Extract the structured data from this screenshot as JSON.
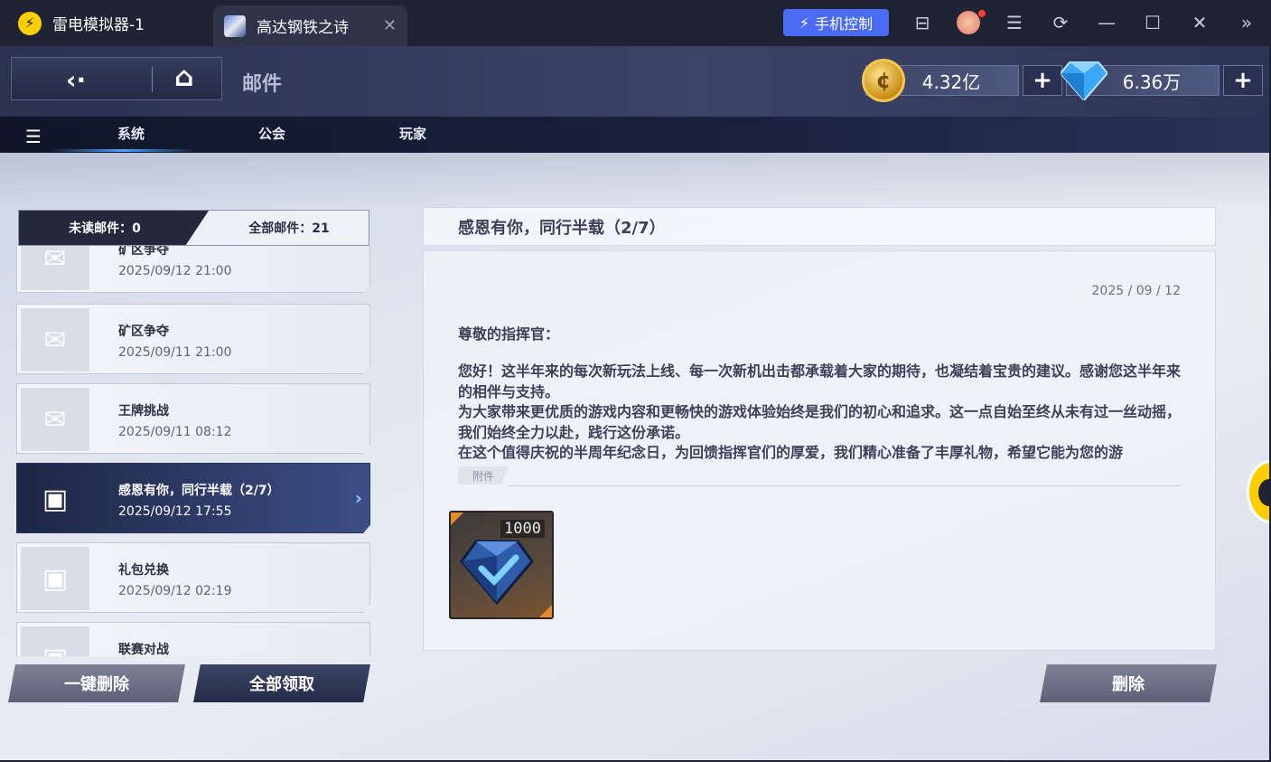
{
  "emulator": {
    "app_title": "雷电模拟器-1",
    "game_tab_title": "高达钢铁之诗",
    "phone_control_label": "手机控制",
    "tab_close": "✕",
    "icons": [
      "lightning-icon",
      "toolbox-icon",
      "avatar-icon",
      "menu-icon",
      "rotate-icon",
      "minimize-icon",
      "maximize-icon",
      "close-icon",
      "more-icon"
    ]
  },
  "game": {
    "page_title": "邮件",
    "currency": {
      "gold": "4.32亿",
      "diamond": "6.36万",
      "plus": "+"
    },
    "tabs": [
      "系统",
      "公会",
      "玩家"
    ],
    "active_tab": "系统",
    "counter": {
      "unread": "未读邮件：0",
      "all": "全部邮件：21"
    },
    "mails": [
      {
        "title": "矿区争夺",
        "date": "2025/09/12  21:00",
        "icon": "envelope-icon",
        "active": false
      },
      {
        "title": "矿区争夺",
        "date": "2025/09/11  21:00",
        "icon": "envelope-icon",
        "active": false
      },
      {
        "title": "王牌挑战",
        "date": "2025/09/11  08:12",
        "icon": "envelope-icon",
        "active": false
      },
      {
        "title": "感恩有你，同行半载（2/7）",
        "date": "2025/09/12  17:55",
        "icon": "giftbox-icon",
        "active": true
      },
      {
        "title": "礼包兑换",
        "date": "2025/09/12  02:19",
        "icon": "giftbox-icon",
        "active": false
      },
      {
        "title": "联赛对战",
        "date": "",
        "icon": "giftbox-icon",
        "active": false
      }
    ],
    "buttons": {
      "delete_all": "一键删除",
      "claim_all": "全部领取",
      "delete": "删除"
    },
    "detail": {
      "title": "感恩有你，同行半载（2/7）",
      "date": "2025 / 09 / 12",
      "greeting": "尊敬的指挥官：",
      "paragraphs": [
        "您好！这半年来的每次新玩法上线、每一次新机出击都承载着大家的期待，也凝结着宝贵的建议。感谢您这半年来的相伴与支持。",
        "为大家带来更优质的游戏内容和更畅快的游戏体验始终是我们的初心和追求。这一点自始至终从未有过一丝动摇，我们始终全力以赴，践行这份承诺。",
        "在这个值得庆祝的半周年纪念日，为回馈指挥官们的厚爱，我们精心准备了丰厚礼物，希望它能为您的游"
      ],
      "attachment_label": "附件",
      "reward": {
        "quantity": "1000",
        "icon": "blue-gem-icon"
      }
    }
  },
  "colors": {
    "emulator_bg": "#1f2333",
    "phone_control_bg": "#4a6bf4",
    "active_mail_bg": "#2a3360",
    "accent_line": "#4aa3ff"
  }
}
